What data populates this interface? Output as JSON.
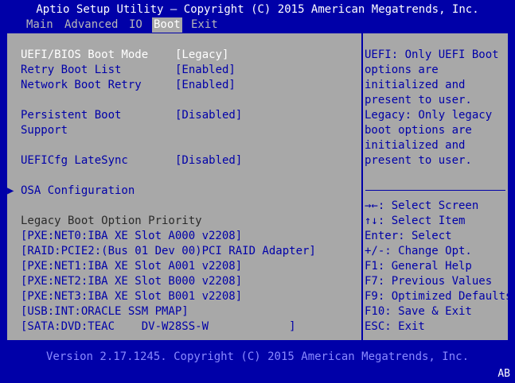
{
  "title": "Aptio Setup Utility – Copyright (C) 2015 American Megatrends, Inc.",
  "menus": [
    "Main",
    "Advanced",
    "IO",
    "Boot",
    "Exit"
  ],
  "active_menu": "Boot",
  "settings": [
    {
      "label": "UEFI/BIOS Boot Mode",
      "value": "[Legacy]"
    },
    {
      "label": "Retry Boot List",
      "value": "[Enabled]"
    },
    {
      "label": "Network Boot Retry",
      "value": "[Enabled]"
    },
    {
      "label": "Persistent Boot",
      "label2": "Support",
      "value": "[Disabled]"
    },
    {
      "label": "UEFICfg LateSync",
      "value": "[Disabled]"
    }
  ],
  "submenu": "OSA Configuration",
  "priority_header": "Legacy Boot Option Priority",
  "boot_options": [
    "[PXE:NET0:IBA XE Slot A000 v2208]",
    "[RAID:PCIE2:(Bus 01 Dev 00)PCI RAID Adapter]",
    "[PXE:NET1:IBA XE Slot A001 v2208]",
    "[PXE:NET2:IBA XE Slot B000 v2208]",
    "[PXE:NET3:IBA XE Slot B001 v2208]",
    "[USB:INT:ORACLE SSM PMAP]",
    "[SATA:DVD:TEAC    DV-W28SS-W            ]"
  ],
  "help_text": [
    "UEFI: Only UEFI Boot",
    "options are",
    "initialized and",
    "present to user.",
    "Legacy: Only legacy",
    "boot options are",
    "initialized and",
    "present to user."
  ],
  "keys": [
    "→←: Select Screen",
    "↑↓: Select Item",
    "Enter: Select",
    "+/-: Change Opt.",
    "F1: General Help",
    "F7: Previous Values",
    "F9: Optimized Defaults",
    "F10: Save & Exit",
    "ESC: Exit"
  ],
  "footer": "Version 2.17.1245. Copyright (C) 2015 American Megatrends, Inc.",
  "corner_badge": "AB",
  "colors": {
    "background": "#0000a8",
    "panel": "#a8a8a8",
    "highlight": "#ffffff",
    "text": "#0000a8"
  }
}
